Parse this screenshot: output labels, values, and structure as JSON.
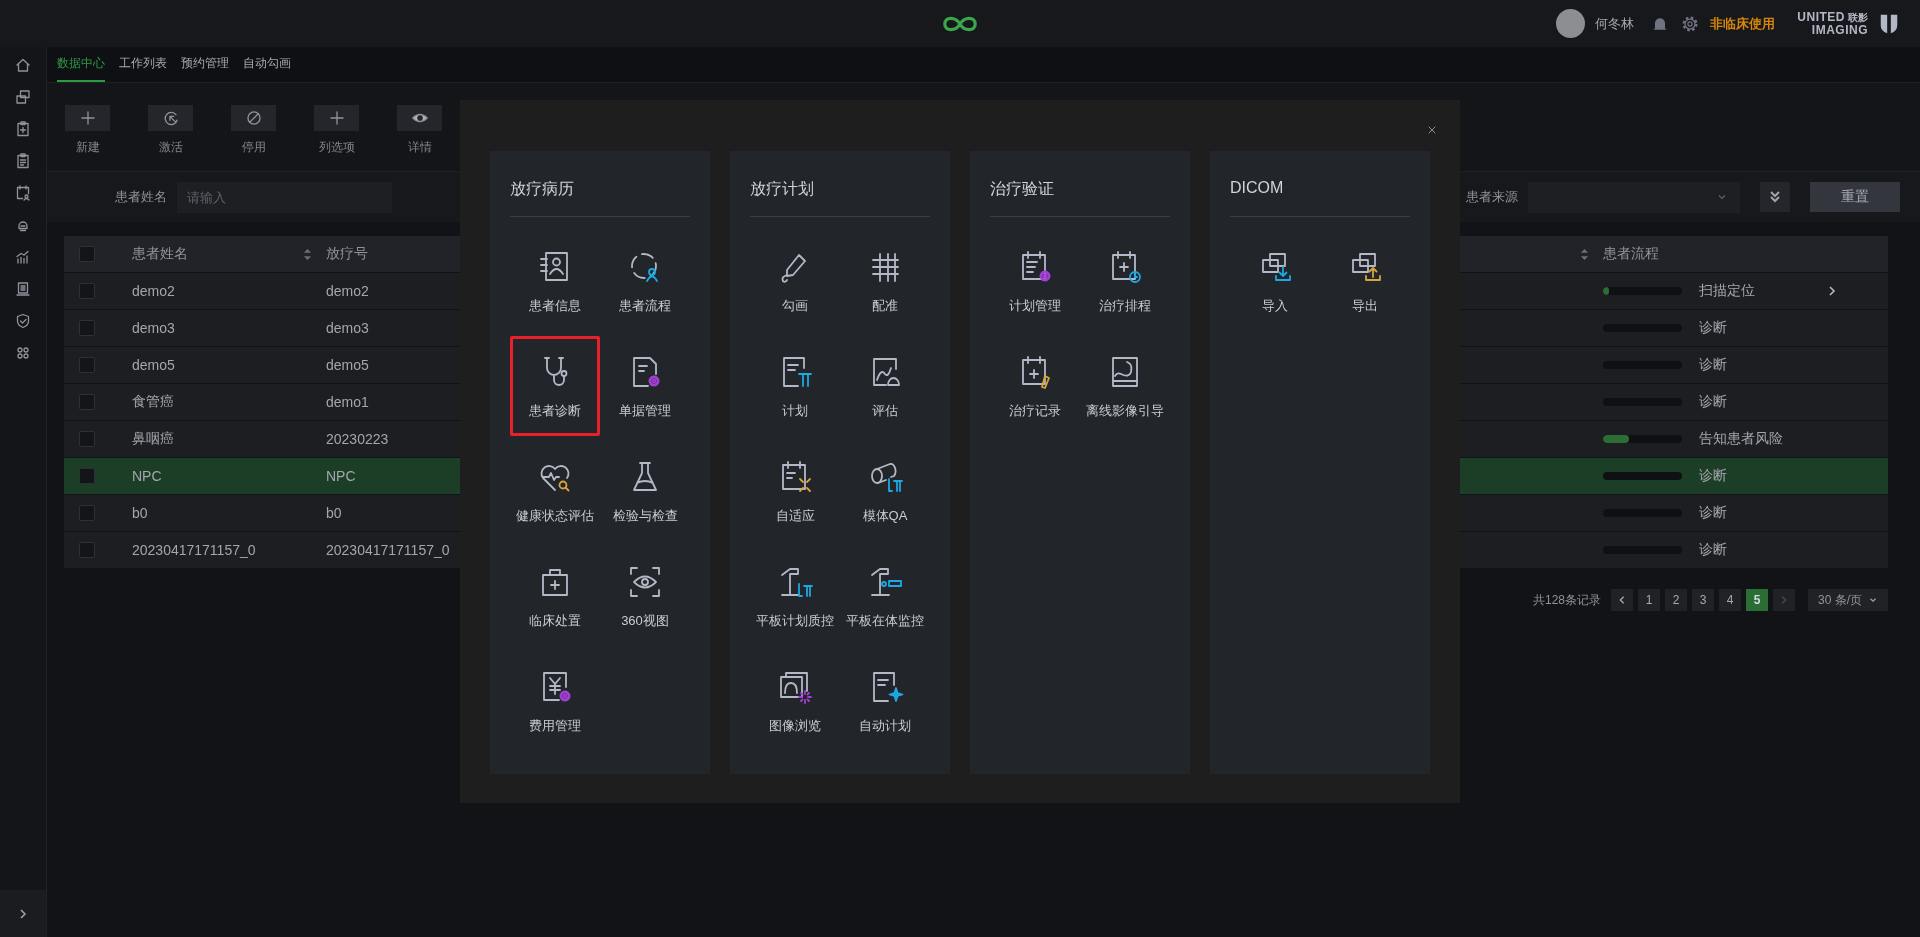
{
  "header": {
    "user_name": "何冬林",
    "usage_notice": "非临床使用",
    "brand_en_1": "UNITED",
    "brand_en_2": "IMAGING",
    "brand_cn": "联影"
  },
  "tabs": [
    {
      "label": "数据中心",
      "selected": true
    },
    {
      "label": "工作列表",
      "selected": false
    },
    {
      "label": "预约管理",
      "selected": false
    },
    {
      "label": "自动勾画",
      "selected": false
    }
  ],
  "toolbar": [
    {
      "label": "新建"
    },
    {
      "label": "激活"
    },
    {
      "label": "停用"
    },
    {
      "label": "列选项"
    },
    {
      "label": "详情"
    }
  ],
  "filters": [
    {
      "label": "患者姓名",
      "placeholder": "请输入"
    },
    {
      "label": "患者来源"
    }
  ],
  "reset_button": "重置",
  "table": {
    "header_checked": false,
    "columns": [
      {
        "label": "患者姓名",
        "sortable": true
      },
      {
        "label": "放疗号",
        "sortable": false
      },
      {
        "sortable": true
      },
      {
        "label": "患者流程",
        "sortable": false
      }
    ],
    "rows": [
      {
        "checked": false,
        "selected": false,
        "name": "demo2",
        "rt_number": "demo2",
        "progress": {
          "level": 0.08
        },
        "stage": "扫描定位",
        "expandable": true
      },
      {
        "checked": false,
        "selected": false,
        "name": "demo3",
        "rt_number": "demo3",
        "progress": {
          "level": 0
        },
        "stage": "诊断",
        "expandable": false
      },
      {
        "checked": false,
        "selected": false,
        "name": "demo5",
        "rt_number": "demo5",
        "progress": {
          "level": 0
        },
        "stage": "诊断",
        "expandable": false
      },
      {
        "checked": false,
        "selected": false,
        "name": "食管癌",
        "rt_number": "demo1",
        "progress": {
          "level": 0
        },
        "stage": "诊断",
        "expandable": false
      },
      {
        "checked": false,
        "selected": false,
        "name": "鼻咽癌",
        "rt_number": "20230223",
        "progress": {
          "level": 0.33
        },
        "stage": "告知患者风险",
        "expandable": false
      },
      {
        "checked": false,
        "selected": true,
        "name": "NPC",
        "rt_number": "NPC",
        "progress": {
          "level": 0
        },
        "stage": "诊断",
        "expandable": false
      },
      {
        "checked": false,
        "selected": false,
        "name": "b0",
        "rt_number": "b0",
        "progress": {
          "level": 0
        },
        "stage": "诊断",
        "expandable": false
      },
      {
        "checked": false,
        "selected": false,
        "name": "20230417171157_0",
        "rt_number": "20230417171157_0",
        "progress": {
          "level": 0
        },
        "stage": "诊断",
        "expandable": false
      }
    ]
  },
  "pagination": {
    "total": "共128条记录",
    "prev_disabled": false,
    "next_disabled": true,
    "pages": [
      {
        "label": "1",
        "selected": false
      },
      {
        "label": "2",
        "selected": false
      },
      {
        "label": "3",
        "selected": false
      },
      {
        "label": "4",
        "selected": false
      },
      {
        "label": "5",
        "selected": true
      }
    ],
    "page_size": "30 条/页"
  },
  "modal": {
    "sections": [
      {
        "title": "放疗病历",
        "items": [
          {
            "label": "患者信息",
            "highlighted": false
          },
          {
            "label": "患者流程",
            "highlighted": false
          },
          {
            "label": "患者诊断",
            "highlighted": true
          },
          {
            "label": "单据管理",
            "highlighted": false
          },
          {
            "label": "健康状态评估",
            "highlighted": false
          },
          {
            "label": "检验与检查",
            "highlighted": false
          },
          {
            "label": "临床处置",
            "highlighted": false
          },
          {
            "label": "360视图",
            "highlighted": false
          },
          {
            "label": "费用管理",
            "highlighted": false
          }
        ]
      },
      {
        "title": "放疗计划",
        "items": [
          {
            "label": "勾画",
            "highlighted": false
          },
          {
            "label": "配准",
            "highlighted": false
          },
          {
            "label": "计划",
            "highlighted": false
          },
          {
            "label": "评估",
            "highlighted": false
          },
          {
            "label": "自适应",
            "highlighted": false
          },
          {
            "label": "模体QA",
            "highlighted": false
          },
          {
            "label": "平板计划质控",
            "highlighted": false
          },
          {
            "label": "平板在体监控",
            "highlighted": false
          },
          {
            "label": "图像浏览",
            "highlighted": false
          },
          {
            "label": "自动计划",
            "highlighted": false
          }
        ]
      },
      {
        "title": "治疗验证",
        "items": [
          {
            "label": "计划管理",
            "highlighted": false
          },
          {
            "label": "治疗排程",
            "highlighted": false
          },
          {
            "label": "治疗记录",
            "highlighted": false
          },
          {
            "label": "离线影像引导",
            "highlighted": false
          }
        ]
      },
      {
        "title": "DICOM",
        "items": [
          {
            "label": "导入",
            "highlighted": false
          },
          {
            "label": "导出",
            "highlighted": false
          }
        ]
      }
    ]
  }
}
